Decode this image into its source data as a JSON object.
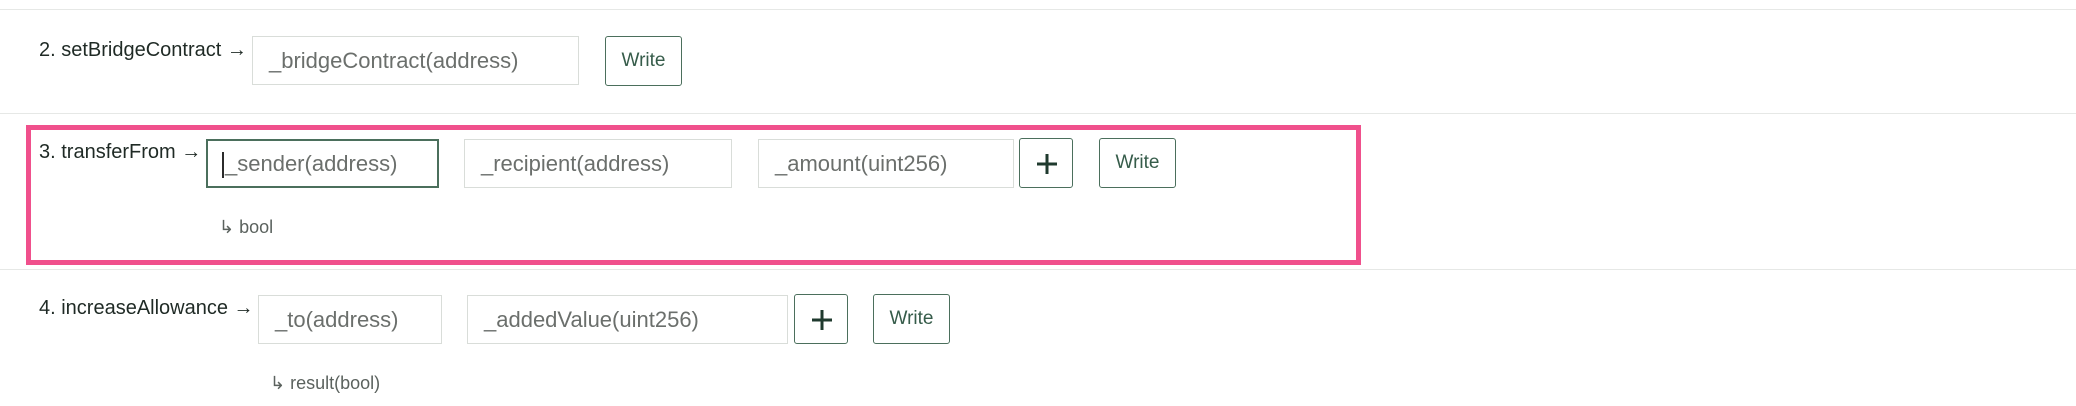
{
  "functions": [
    {
      "label": "2. setBridgeContract →",
      "inputs": [
        "_bridgeContract(address)"
      ],
      "write_label": "Write"
    },
    {
      "label": "3. transferFrom →",
      "inputs": [
        "_sender(address)",
        "_recipient(address)",
        "_amount(uint256)"
      ],
      "write_label": "Write",
      "returns": "↳ bool"
    },
    {
      "label": "4. increaseAllowance →",
      "inputs": [
        "_to(address)",
        "_addedValue(uint256)"
      ],
      "write_label": "Write",
      "returns": "↳ result(bool)"
    }
  ],
  "icons": {
    "add": "plus-icon"
  },
  "colors": {
    "highlight": "#f0508c",
    "accent": "#4b6f5c"
  }
}
